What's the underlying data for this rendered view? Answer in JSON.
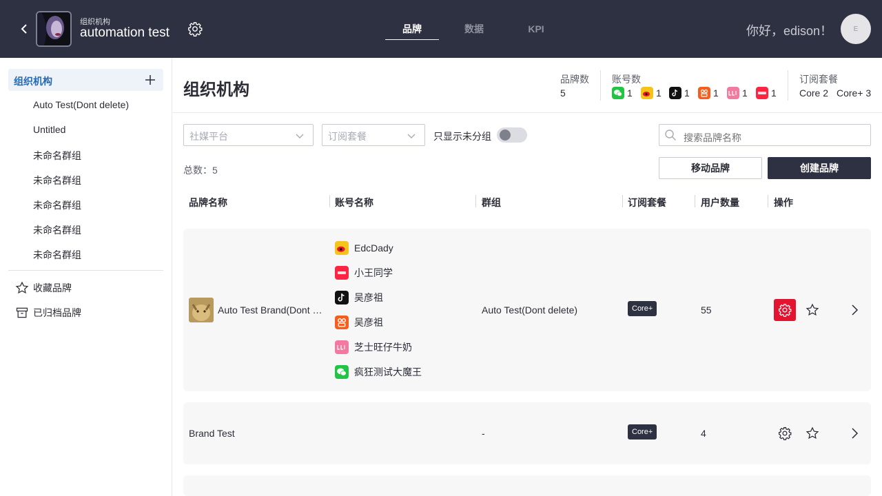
{
  "header": {
    "org_subtitle": "组织机构",
    "org_title": "automation test",
    "tabs": [
      {
        "label": "品牌"
      },
      {
        "label": "数据"
      },
      {
        "label": "KPI"
      }
    ],
    "greeting": "你好，edison！",
    "avatar_initial": "E"
  },
  "sidebar": {
    "heading": "组织机构",
    "items": [
      {
        "label": "Auto Test(Dont delete)"
      },
      {
        "label": "Untitled"
      },
      {
        "label": "未命名群组"
      },
      {
        "label": "未命名群组"
      },
      {
        "label": "未命名群组"
      },
      {
        "label": "未命名群组"
      },
      {
        "label": "未命名群组"
      }
    ],
    "favorites": "收藏品牌",
    "archived": "已归档品牌"
  },
  "main": {
    "title": "组织机构",
    "stats": {
      "brand_count_label": "品牌数",
      "brand_count": "5",
      "account_count_label": "账号数",
      "platforms": [
        {
          "icon": "wechat-icon",
          "count": "1"
        },
        {
          "icon": "weibo-icon",
          "count": "1"
        },
        {
          "icon": "douyin-icon",
          "count": "1"
        },
        {
          "icon": "kuaishou-icon",
          "count": "1"
        },
        {
          "icon": "lulu-icon",
          "count": "1"
        },
        {
          "icon": "xiaohongshu-icon",
          "count": "1"
        }
      ],
      "subscription_label": "订阅套餐",
      "core": "Core 2",
      "core_plus": "Core+ 3"
    },
    "filters": {
      "platform_placeholder": "社媒平台",
      "plan_placeholder": "订阅套餐",
      "toggle_label": "只显示未分组",
      "search_placeholder": "搜索品牌名称"
    },
    "total": "总数：5",
    "buttons": {
      "move": "移动品牌",
      "create": "创建品牌"
    },
    "columns": {
      "brand": "品牌名称",
      "account": "账号名称",
      "group": "群组",
      "plan": "订阅套餐",
      "users": "用户数量",
      "actions": "操作"
    },
    "rows": [
      {
        "brand": "Auto Test Brand(Dont …",
        "accounts": [
          {
            "icon": "weibo-icon",
            "name": "EdcDady"
          },
          {
            "icon": "xiaohongshu-icon",
            "name": "小王同学"
          },
          {
            "icon": "douyin-icon",
            "name": "吴彦祖"
          },
          {
            "icon": "kuaishou-icon",
            "name": "吴彦祖"
          },
          {
            "icon": "lulu-icon",
            "name": "芝士旺仔牛奶"
          },
          {
            "icon": "wechat-icon",
            "name": "疯狂测试大魔王"
          }
        ],
        "group": "Auto Test(Dont delete)",
        "plan": "Core+",
        "users": "55"
      },
      {
        "brand": "Brand Test",
        "accounts": [],
        "group": "-",
        "plan": "Core+",
        "users": "4"
      }
    ]
  },
  "colors": {
    "header_bg": "#2e3142",
    "accent_blue": "#2469b3",
    "danger_red": "#e3142f"
  }
}
